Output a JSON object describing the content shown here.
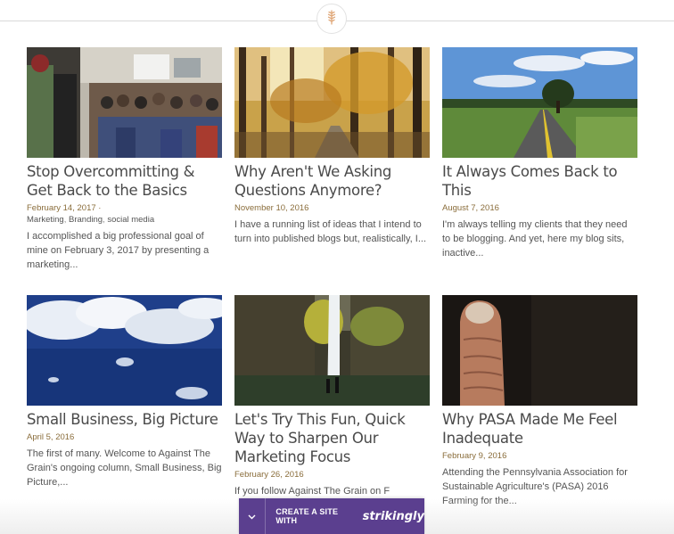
{
  "colors": {
    "date": "#8a6d3b",
    "title": "#4a4a4a",
    "promo_bg": "#5b3f8f"
  },
  "header": {
    "logo_icon": "wheat-icon"
  },
  "posts": [
    {
      "title": "Stop Overcommitting & Get Back to the Basics",
      "date": "February 14, 2017 ·",
      "tags": [
        "Marketing",
        "Branding",
        "social media"
      ],
      "excerpt": "I accomplished a big professional goal of mine on February 3, 2017 by presenting a marketing...",
      "image": "conference-audience-photo"
    },
    {
      "title": "Why Aren't We Asking Questions Anymore?",
      "date": "November 10, 2016",
      "excerpt": "I have a running list of ideas that I intend to turn into published blogs but, realistically, I...",
      "image": "autumn-forest-path-photo"
    },
    {
      "title": "It Always Comes Back to This",
      "date": "August 7, 2016",
      "excerpt": "I'm always telling my clients that they need to be blogging. And yet, here my blog sits, inactive...",
      "image": "country-road-photo"
    },
    {
      "title": "Small Business, Big Picture",
      "date": "April 5, 2016",
      "excerpt": "The first of many. Welcome to Against The Grain's ongoing column, Small Business, Big Picture,...",
      "image": "cloudy-sky-photo"
    },
    {
      "title": "Let's Try This Fun, Quick Way to Sharpen Our Marketing Focus",
      "date": "February 26, 2016",
      "excerpt": "If you follow Against The Grain on F",
      "image": "waterfall-photo"
    },
    {
      "title": "Why PASA Made Me Feel Inadequate",
      "date": "February 9, 2016",
      "excerpt": "Attending the Pennsylvania Association for Sustainable Agriculture's (PASA) 2016 Farming for the...",
      "image": "dirty-thumb-photo"
    }
  ],
  "promo": {
    "label": "CREATE A SITE WITH",
    "brand": "strikingly",
    "icon": "chevron-down-icon"
  }
}
